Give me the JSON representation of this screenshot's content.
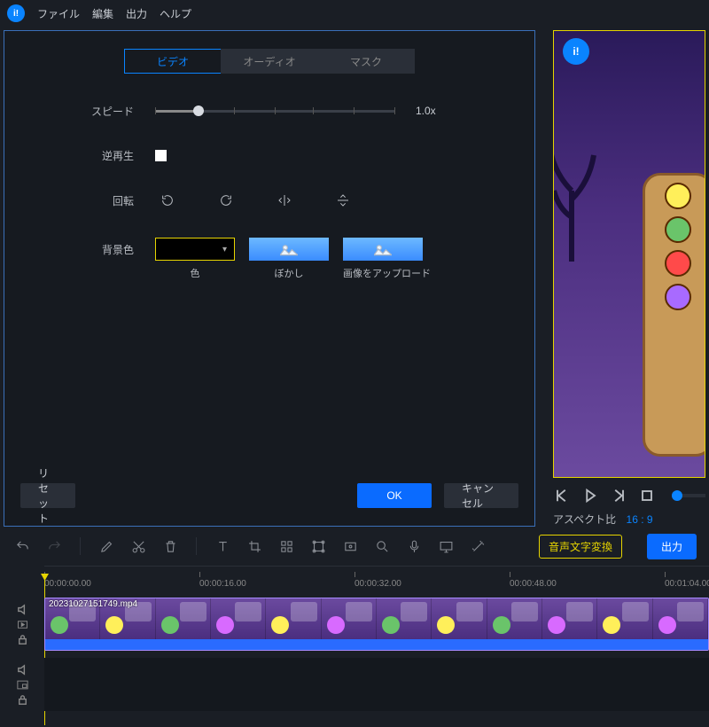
{
  "menu": {
    "file": "ファイル",
    "edit": "編集",
    "output": "出力",
    "help": "ヘルプ"
  },
  "dialog": {
    "tabs": {
      "video": "ビデオ",
      "audio": "オーディオ",
      "mask": "マスク"
    },
    "speed": {
      "label": "スピード",
      "value": "1.0x"
    },
    "reverse": {
      "label": "逆再生"
    },
    "rotate": {
      "label": "回転"
    },
    "bg": {
      "label": "背景色",
      "color": "色",
      "blur": "ぼかし",
      "upload": "画像をアップロード"
    },
    "buttons": {
      "reset": "リセット",
      "ok": "OK",
      "cancel": "キャンセル"
    }
  },
  "preview": {
    "aspect_label": "アスペクト比",
    "aspect_value": "16 : 9"
  },
  "toolbar": {
    "voice_to_text": "音声文字変換",
    "export": "出力"
  },
  "timeline": {
    "marks": [
      "00:00:00.00",
      "00:00:16.00",
      "00:00:32.00",
      "00:00:48.00",
      "00:01:04.00"
    ],
    "clip_name": "20231027151749.mp4"
  }
}
